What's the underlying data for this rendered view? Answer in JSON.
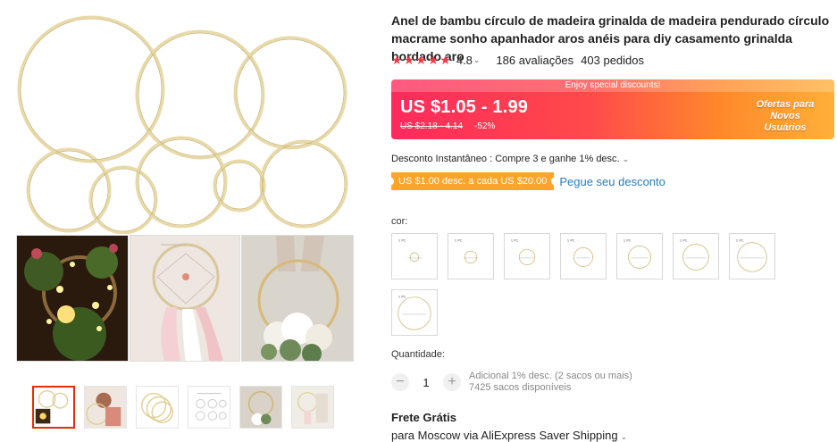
{
  "product": {
    "title": "Anel de bambu círculo de madeira grinalda de madeira pendurado círculo macrame sonho apanhador aros anéis para diy casamento grinalda bordado aro",
    "rating": {
      "stars": 5,
      "value": "4.8",
      "reviews_label": "186 avaliações",
      "orders_label": "403 pedidos"
    },
    "price": {
      "banner_strip": "Enjoy special discounts!",
      "current": "US $1.05 - 1.99",
      "original": "US $2.18 - 4.14",
      "discount": "-52%",
      "promo_badge": "Ofertas para Novos Usuários"
    },
    "instant_discount": "Desconto Instantâneo : Compre 3 e ganhe 1% desc.",
    "coupon": {
      "label": "US $1.00 desc. a cada US $20.00",
      "link": "Pegue seu desconto"
    },
    "color_label": "cor:",
    "quantity": {
      "label": "Quantidade:",
      "value": "1",
      "minus": "−",
      "plus": "+",
      "note_line1": "Adicional 1% desc. (2 sacos ou mais)",
      "note_line2": "7425 sacos disponíveis"
    },
    "shipping": {
      "title": "Frete Grátis",
      "detail": "para Moscow via AliExpress Saver Shipping"
    }
  },
  "colors": {
    "accent_red": "#e62e04",
    "star": "#f13a45",
    "link": "#2a7bc2",
    "coupon": "#ffa42a",
    "banner_start": "#ff2a5c",
    "banner_end": "#ffb03a",
    "bamboo": "#e8d9a6"
  },
  "icons": {
    "star": "star-icon",
    "chevron": "chevron-down-icon",
    "minus": "minus-icon",
    "plus": "plus-icon"
  }
}
